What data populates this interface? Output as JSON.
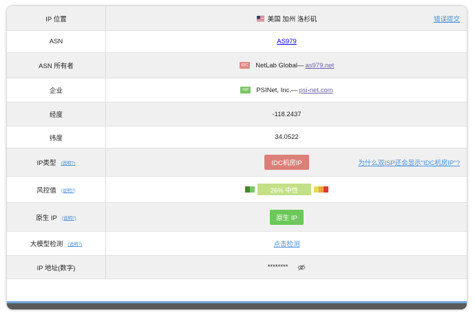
{
  "rows": {
    "ip_location": {
      "label": "IP 位置",
      "value": "美国 加州 洛杉矶",
      "action": "错误提交"
    },
    "asn": {
      "label": "ASN",
      "value": "AS979"
    },
    "asn_owner": {
      "label": "ASN 所有者",
      "tag": "IDC",
      "name": "NetLab Global— ",
      "link": "as979.net"
    },
    "company": {
      "label": "企业",
      "tag": "ISP",
      "name": "PSINet, Inc.— ",
      "link": "psi-net.com"
    },
    "longitude": {
      "label": "经度",
      "value": "-118.2437"
    },
    "latitude": {
      "label": "纬度",
      "value": "34.0522"
    },
    "ip_type": {
      "label": "IP类型",
      "help": "(说明?)",
      "value": "IDC机房IP",
      "question": "为什么双ISP还会显示\"IDC机房IP\"?"
    },
    "risk": {
      "label": "风控值",
      "help": "(说明?)",
      "value": "26%  中性",
      "level_percent": 26
    },
    "native_ip": {
      "label": "原生 IP",
      "help": "(说明?)",
      "value": "原生 IP"
    },
    "llm_detect": {
      "label": "大模型检测",
      "help": "(说明?)",
      "value": "点击检测"
    },
    "ip_numeric": {
      "label": "IP 地址(数字)",
      "value": "********"
    }
  },
  "icons": {
    "flag": "us-flag-icon",
    "visibility": "eye-off-icon"
  },
  "colors": {
    "link": "#4a90d9",
    "idc_badge": "#dd7f79",
    "native_badge": "#6cc85a",
    "risk_bar": "#c3e087"
  }
}
